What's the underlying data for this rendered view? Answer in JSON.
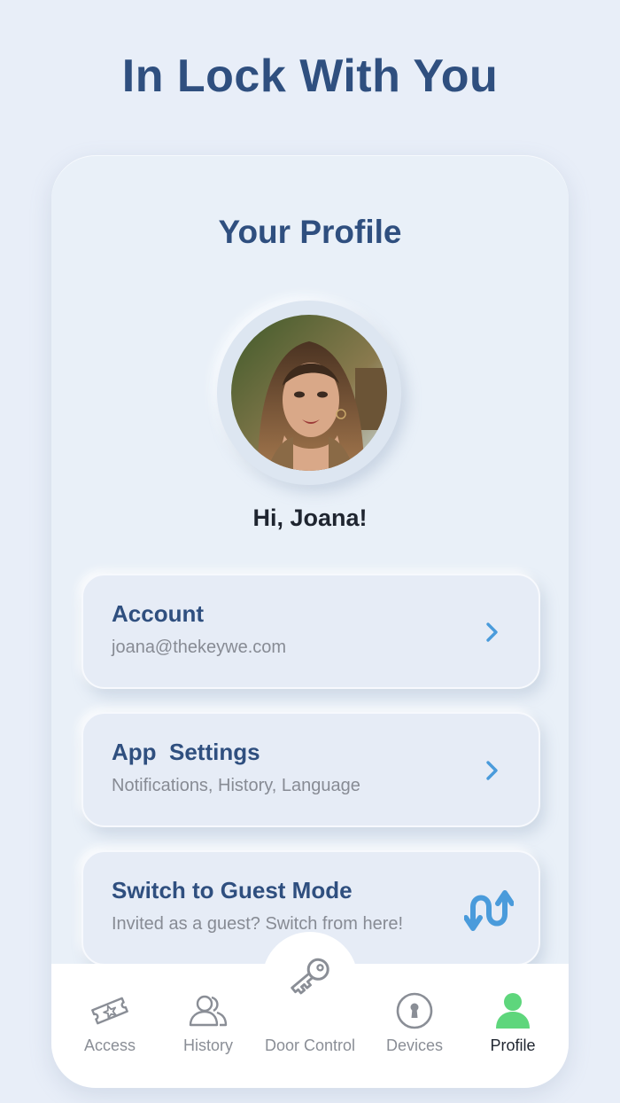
{
  "headline": "In Lock With You",
  "screen": {
    "title": "Your Profile",
    "greeting": "Hi, Joana!"
  },
  "cards": [
    {
      "title": "Account",
      "subtitle": "joana@thekeywe.com",
      "icon": "chevron-right-icon"
    },
    {
      "title": "App  Settings",
      "subtitle": "Notifications, History, Language",
      "icon": "chevron-right-icon"
    },
    {
      "title": "Switch to Guest Mode",
      "subtitle": "Invited as a guest? Switch from here!",
      "icon": "swap-arrows-icon"
    }
  ],
  "nav": [
    {
      "label": "Access",
      "icon": "ticket-icon"
    },
    {
      "label": "History",
      "icon": "users-icon"
    },
    {
      "label": "Door Control",
      "icon": "key-icon"
    },
    {
      "label": "Devices",
      "icon": "keyhole-icon"
    },
    {
      "label": "Profile",
      "icon": "person-icon",
      "active": true
    }
  ],
  "colors": {
    "background": "#e8eef8",
    "primary_text": "#2f4f7f",
    "accent_blue": "#4a9bdb",
    "active_nav": "#5ed67c",
    "muted": "#8a8e96"
  }
}
